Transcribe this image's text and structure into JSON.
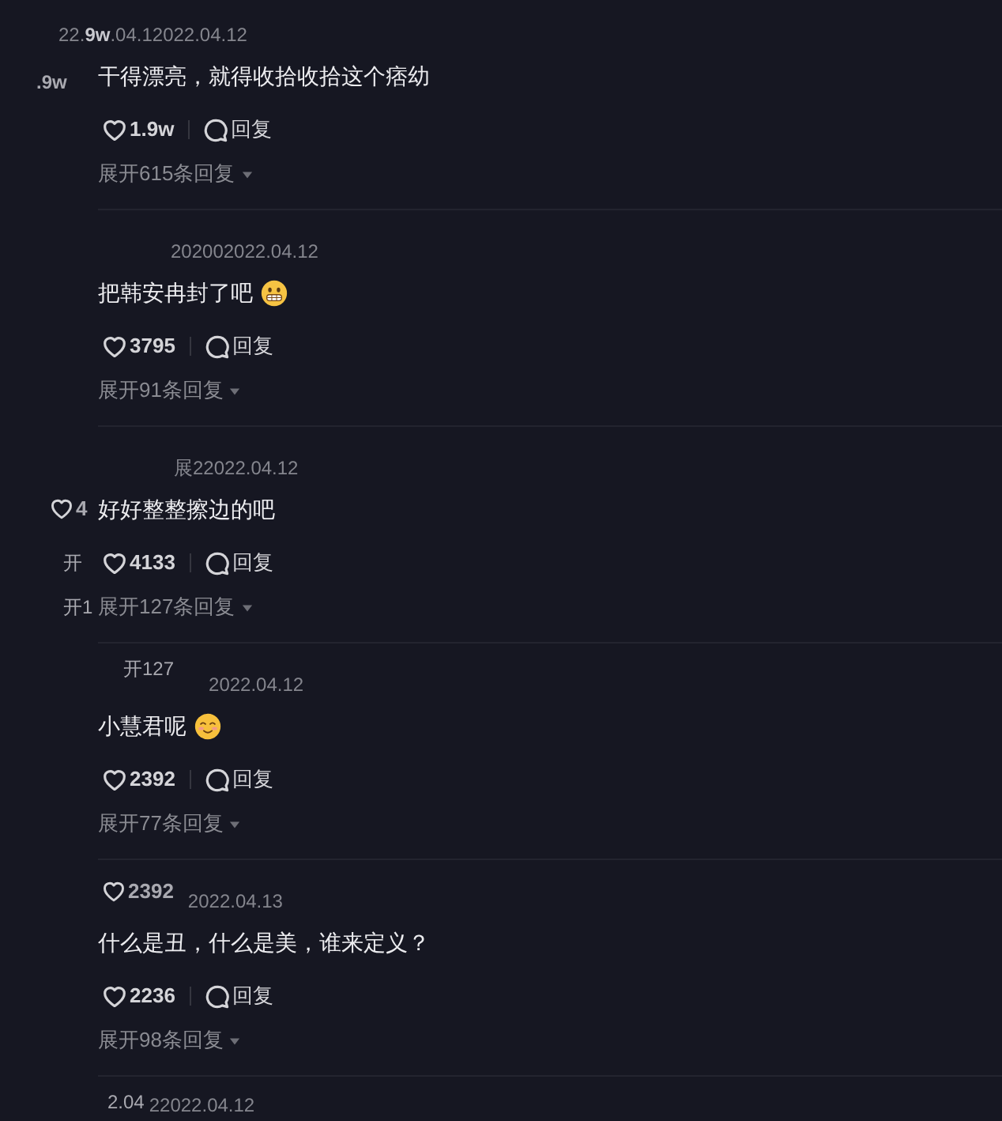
{
  "comments": [
    {
      "date": "22.**9w**.04.12022.04.12",
      "text": "干得漂亮，就得收拾收拾这个痞幼",
      "likes": "1.9w",
      "reply": "回复",
      "expand": "展开615条回复",
      "text_fragments": [
        {
          "kind": "plain",
          "text": ".9w"
        }
      ]
    },
    {
      "date": "202002022.04.12",
      "text": "把韩安冉封了吧",
      "emojis": [
        {
          "kind": "grimace"
        }
      ],
      "likes": "3795",
      "reply": "回复",
      "expand": "展开91条回复"
    },
    {
      "date": "展22022.04.12",
      "text": "好好整整擦边的吧",
      "likes": "4133",
      "reply": "回复",
      "expand": "展开127条回复",
      "text_fragments": [
        {
          "kind": "like",
          "text": "4"
        }
      ],
      "action_fragments": [
        {
          "kind": "plain",
          "text": "开"
        }
      ],
      "expand_fragments": [
        {
          "kind": "plain",
          "text": "开1"
        }
      ]
    },
    {
      "date": "2022.04.12",
      "text": "小慧君呢",
      "emojis": [
        {
          "kind": "blush"
        }
      ],
      "likes": "2392",
      "reply": "回复",
      "expand": "展开77条回复",
      "date_fragments": [
        {
          "kind": "plain",
          "text": "开127"
        }
      ]
    },
    {
      "date": "2022.04.13",
      "text": "什么是丑，什么是美，谁来定义？",
      "likes": "2236",
      "reply": "回复",
      "expand": "展开98条回复",
      "date_fragments": [
        {
          "kind": "like",
          "text": "2392"
        }
      ]
    }
  ],
  "partial_comment": {
    "date": "22022.04.12",
    "date_fragments": [
      {
        "kind": "plain",
        "text": "2.04"
      }
    ]
  }
}
